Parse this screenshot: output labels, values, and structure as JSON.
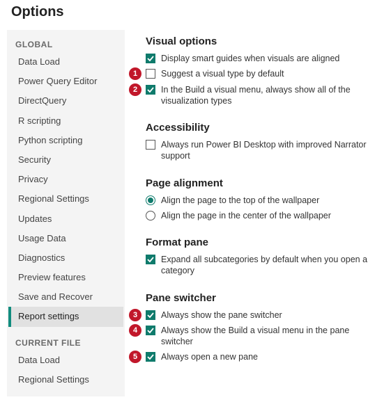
{
  "title": "Options",
  "sidebar": {
    "section1_label": "GLOBAL",
    "section1_items": [
      "Data Load",
      "Power Query Editor",
      "DirectQuery",
      "R scripting",
      "Python scripting",
      "Security",
      "Privacy",
      "Regional Settings",
      "Updates",
      "Usage Data",
      "Diagnostics",
      "Preview features",
      "Save and Recover",
      "Report settings"
    ],
    "section1_selected_index": 13,
    "section2_label": "CURRENT FILE",
    "section2_items": [
      "Data Load",
      "Regional Settings"
    ]
  },
  "content": {
    "visual_options": {
      "heading": "Visual options",
      "opt1": {
        "label": "Display smart guides when visuals are aligned",
        "checked": true
      },
      "opt2": {
        "label": "Suggest a visual type by default",
        "checked": false,
        "callout": "1"
      },
      "opt3": {
        "label": "In the Build a visual menu, always show all of the visualization types",
        "checked": true,
        "callout": "2"
      }
    },
    "accessibility": {
      "heading": "Accessibility",
      "opt1": {
        "label": "Always run Power BI Desktop with improved Narrator support",
        "checked": false
      }
    },
    "page_alignment": {
      "heading": "Page alignment",
      "opt1": {
        "label": "Align the page to the top of the wallpaper",
        "selected": true
      },
      "opt2": {
        "label": "Align the page in the center of the wallpaper",
        "selected": false
      }
    },
    "format_pane": {
      "heading": "Format pane",
      "opt1": {
        "label": "Expand all subcategories by default when you open a category",
        "checked": true
      }
    },
    "pane_switcher": {
      "heading": "Pane switcher",
      "opt1": {
        "label": "Always show the pane switcher",
        "checked": true,
        "callout": "3"
      },
      "opt2": {
        "label": "Always show the Build a visual menu in the pane switcher",
        "checked": true,
        "callout": "4"
      },
      "opt3": {
        "label": "Always open a new pane",
        "checked": true,
        "callout": "5"
      }
    }
  }
}
